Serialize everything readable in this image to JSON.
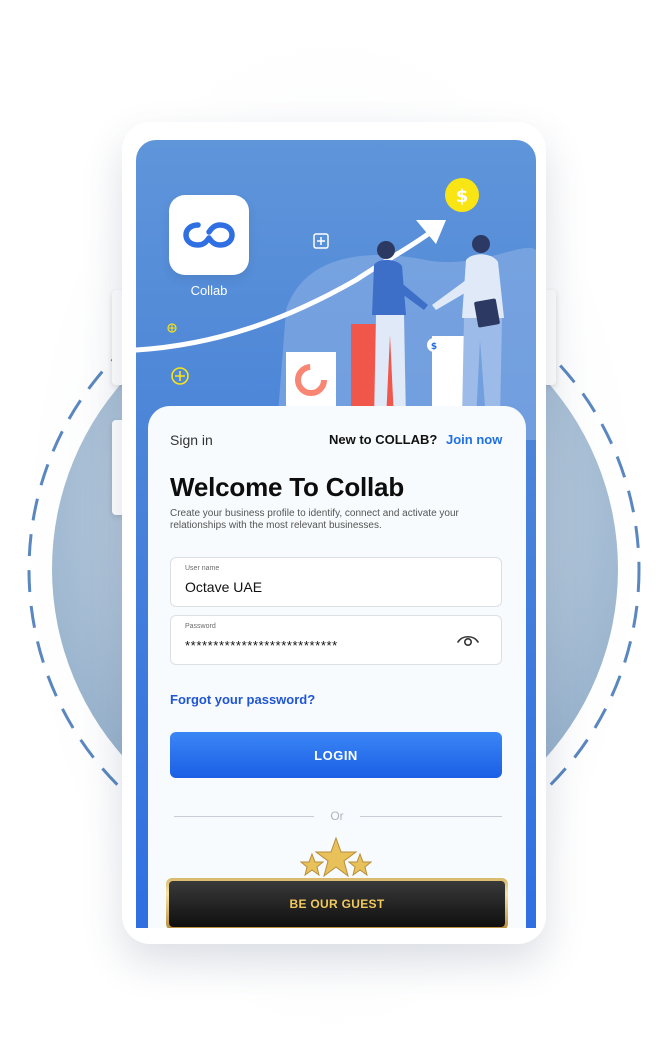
{
  "app": {
    "name": "Collab",
    "icon": "infinity-link-icon"
  },
  "header": {
    "signin_label": "Sign in",
    "new_prompt": "New to COLLAB?",
    "join_label": "Join now"
  },
  "welcome": {
    "title": "Welcome To Collab",
    "subtitle": "Create your business profile to identify, connect and activate your relationships with the most relevant businesses."
  },
  "form": {
    "username": {
      "label": "User name",
      "value": "Octave UAE"
    },
    "password": {
      "label": "Password",
      "value": "***************************",
      "toggle_icon": "eye-icon"
    },
    "forgot_label": "Forgot your password?",
    "login_label": "LOGIN"
  },
  "divider": {
    "text": "Or"
  },
  "guest": {
    "label": "BE OUR GUEST"
  },
  "colors": {
    "primary": "#1f6fe5",
    "gold": "#f0c95c",
    "hero_blue": "#5f95d9"
  }
}
